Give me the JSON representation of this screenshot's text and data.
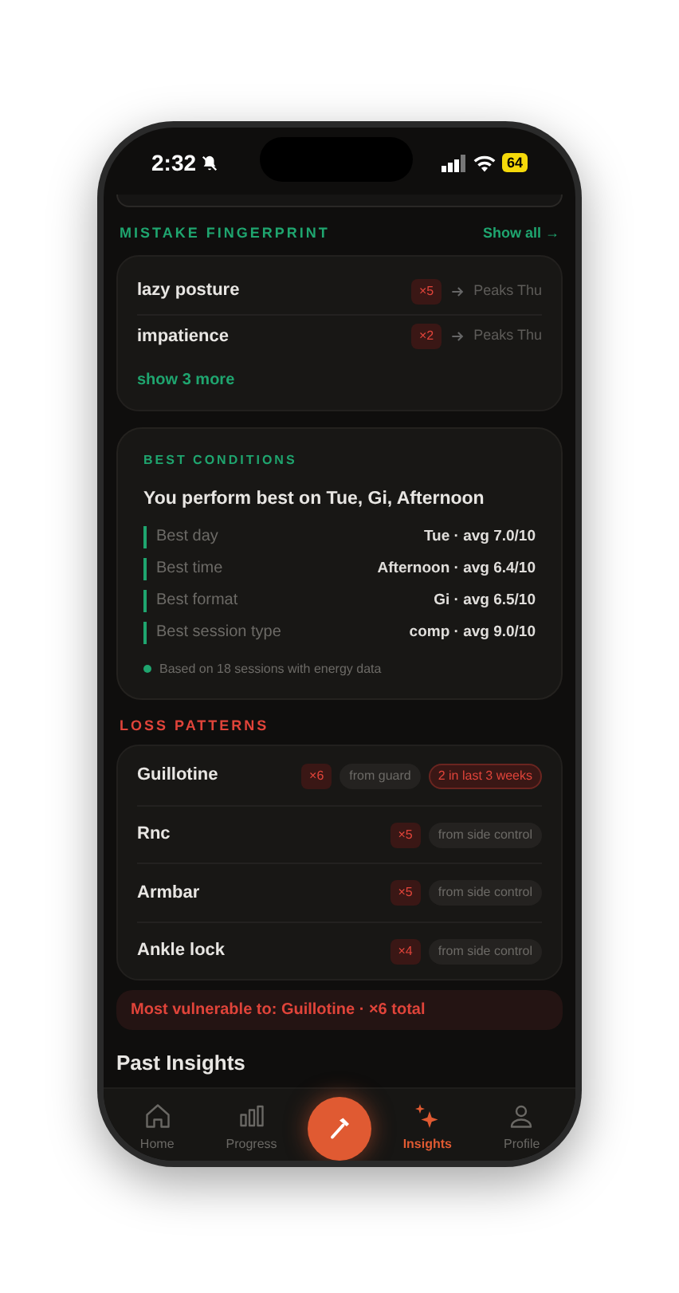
{
  "status_bar": {
    "time": "2:32",
    "battery": "64"
  },
  "mistake_fingerprint": {
    "title": "MISTAKE FINGERPRINT",
    "link": "Show all →",
    "items": [
      {
        "name": "lazy posture",
        "count": "×5",
        "peak": "Peaks Thu"
      },
      {
        "name": "impatience",
        "count": "×2",
        "peak": "Peaks Thu"
      }
    ],
    "more": "show 3 more"
  },
  "best_conditions": {
    "title": "BEST CONDITIONS",
    "headline": "You perform best on Tue, Gi, Afternoon",
    "rows": [
      {
        "label": "Best day",
        "value": "Tue · avg 7.0/10"
      },
      {
        "label": "Best time",
        "value": "Afternoon · avg 6.4/10"
      },
      {
        "label": "Best format",
        "value": "Gi · avg 6.5/10"
      },
      {
        "label": "Best session type",
        "value": "comp · avg 9.0/10"
      }
    ],
    "note": "Based on 18 sessions with energy data"
  },
  "loss_patterns": {
    "title": "LOSS PATTERNS",
    "items": [
      {
        "name": "Guillotine",
        "count": "×6",
        "source": "from guard",
        "recent": "2 in last 3 weeks"
      },
      {
        "name": "Rnc",
        "count": "×5",
        "source": "from side control"
      },
      {
        "name": "Armbar",
        "count": "×5",
        "source": "from side control"
      },
      {
        "name": "Ankle lock",
        "count": "×4",
        "source": "from side control"
      }
    ],
    "summary": "Most vulnerable to: Guillotine · ×6 total"
  },
  "past_insights": {
    "title": "Past Insights"
  },
  "tab_bar": {
    "tabs": [
      {
        "kind": "home",
        "label": "Home",
        "selected": false
      },
      {
        "kind": "progress",
        "label": "Progress",
        "selected": false
      },
      {
        "kind": "action"
      },
      {
        "kind": "insights",
        "label": "Insights",
        "selected": true
      },
      {
        "kind": "profile",
        "label": "Profile",
        "selected": false
      }
    ]
  }
}
